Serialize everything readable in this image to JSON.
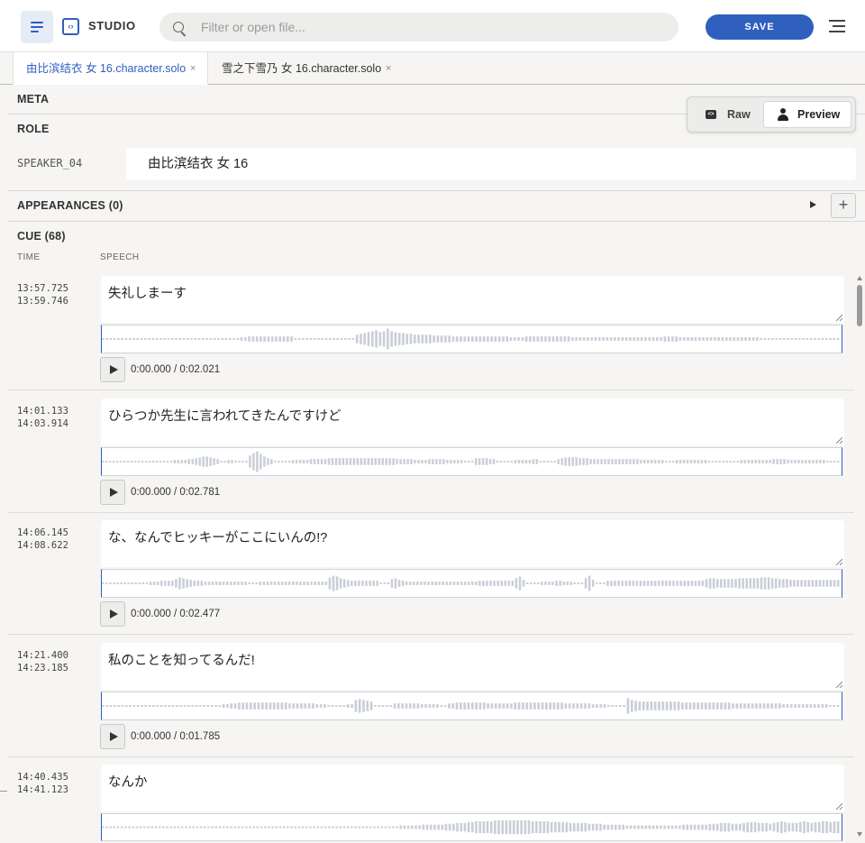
{
  "app": {
    "title": "STUDIO"
  },
  "search": {
    "placeholder": "Filter or open file..."
  },
  "toolbar": {
    "save_label": "SAVE"
  },
  "tabs": [
    {
      "label": "由比滨结衣 女 16.character.solo",
      "close": "×",
      "active": true
    },
    {
      "label": "雪之下雪乃 女 16.character.solo",
      "close": "×",
      "active": false
    }
  ],
  "view_toggle": {
    "raw_label": "Raw",
    "preview_label": "Preview",
    "raw_icon": "<>",
    "selected": "Preview"
  },
  "sections": {
    "meta": "META",
    "role": "ROLE",
    "appearances": "APPEARANCES (0)",
    "appearances_add": "+",
    "cue": "CUE (68)"
  },
  "role": {
    "key": "SPEAKER_04",
    "value": "由比滨结衣 女 16"
  },
  "cue_columns": {
    "time": "TIME",
    "speech": "SPEECH"
  },
  "cues": [
    {
      "start": "13:57.725",
      "end": "13:59.746",
      "text": "失礼しまーす",
      "playback": "0:00.000 / 0:02.021",
      "wave": [
        1,
        1,
        1,
        1,
        1,
        1,
        1,
        1,
        1,
        1,
        1,
        1,
        1,
        1,
        1,
        1,
        1,
        1,
        1,
        1,
        1,
        1,
        1,
        1,
        1,
        1,
        1,
        1,
        1,
        1,
        1,
        1,
        1,
        1,
        1,
        1,
        2,
        2,
        3,
        3,
        3,
        3,
        3,
        3,
        3,
        3,
        3,
        3,
        3,
        3,
        1,
        1,
        1,
        1,
        1,
        1,
        1,
        1,
        1,
        1,
        1,
        1,
        1,
        1,
        1,
        1,
        5,
        6,
        7,
        8,
        9,
        10,
        8,
        9,
        12,
        9,
        8,
        7,
        7,
        6,
        6,
        5,
        5,
        5,
        5,
        5,
        4,
        4,
        4,
        4,
        4,
        3,
        3,
        3,
        3,
        3,
        3,
        3,
        3,
        3,
        3,
        3,
        3,
        3,
        3,
        3,
        2,
        2,
        2,
        2,
        3,
        3,
        3,
        3,
        3,
        3,
        3,
        3,
        3,
        3,
        3,
        3,
        2,
        2,
        2,
        2,
        2,
        2,
        2,
        2,
        2,
        2,
        2,
        2,
        2,
        2,
        2,
        2,
        2,
        2,
        2,
        2,
        2,
        2,
        2,
        2,
        3,
        3,
        3,
        3,
        2,
        2,
        2,
        2,
        2,
        2,
        2,
        2,
        2,
        2,
        2,
        2,
        2,
        2,
        2,
        2,
        2,
        2,
        2,
        2,
        2,
        1,
        1,
        1,
        1,
        1,
        1,
        1,
        1,
        1,
        1,
        1,
        1,
        1,
        1,
        1,
        1,
        1,
        1,
        1,
        1,
        1
      ]
    },
    {
      "start": "14:01.133",
      "end": "14:03.914",
      "text": "ひらつか先生に言われてきたんですけど",
      "playback": "0:00.000 / 0:02.781",
      "wave": [
        1,
        1,
        1,
        1,
        1,
        1,
        1,
        1,
        1,
        1,
        1,
        1,
        1,
        1,
        1,
        1,
        1,
        1,
        1,
        1,
        2,
        2,
        2,
        2,
        3,
        3,
        4,
        5,
        6,
        6,
        5,
        4,
        3,
        1,
        1,
        2,
        2,
        1,
        1,
        1,
        1,
        7,
        10,
        12,
        9,
        6,
        4,
        3,
        1,
        1,
        1,
        1,
        1,
        2,
        2,
        2,
        2,
        2,
        3,
        3,
        3,
        3,
        3,
        4,
        4,
        4,
        4,
        4,
        4,
        4,
        4,
        4,
        4,
        4,
        4,
        4,
        4,
        4,
        4,
        4,
        4,
        4,
        3,
        3,
        3,
        3,
        3,
        2,
        2,
        2,
        2,
        3,
        3,
        3,
        3,
        3,
        2,
        2,
        2,
        2,
        2,
        1,
        1,
        1,
        4,
        4,
        4,
        4,
        3,
        3,
        1,
        1,
        1,
        1,
        1,
        2,
        2,
        2,
        2,
        2,
        3,
        3,
        1,
        1,
        1,
        1,
        1,
        3,
        4,
        5,
        5,
        5,
        5,
        4,
        4,
        4,
        3,
        3,
        3,
        3,
        3,
        3,
        3,
        3,
        3,
        3,
        3,
        3,
        3,
        3,
        2,
        2,
        2,
        2,
        2,
        2,
        2,
        1,
        1,
        1,
        2,
        2,
        2,
        2,
        2,
        2,
        2,
        2,
        2,
        1,
        1,
        1,
        1,
        1,
        1,
        1,
        1,
        1,
        2,
        2,
        2,
        2,
        2,
        2,
        2,
        2,
        2,
        3,
        3,
        3,
        3,
        2,
        2,
        2,
        2,
        2,
        2,
        2,
        2,
        2,
        2,
        2,
        1,
        1,
        1,
        1
      ]
    },
    {
      "start": "14:06.145",
      "end": "14:08.622",
      "text": "な、なんでヒッキーがここにいんの!?",
      "playback": "0:00.000 / 0:02.477",
      "wave": [
        1,
        1,
        1,
        1,
        1,
        1,
        1,
        1,
        1,
        1,
        1,
        1,
        1,
        2,
        2,
        2,
        3,
        3,
        3,
        3,
        5,
        7,
        6,
        5,
        4,
        3,
        3,
        3,
        2,
        2,
        2,
        2,
        2,
        2,
        2,
        2,
        2,
        2,
        2,
        2,
        1,
        1,
        1,
        2,
        2,
        2,
        2,
        2,
        2,
        2,
        2,
        2,
        2,
        2,
        2,
        2,
        2,
        2,
        2,
        2,
        2,
        2,
        7,
        9,
        8,
        6,
        5,
        4,
        3,
        3,
        3,
        3,
        3,
        3,
        3,
        3,
        1,
        1,
        1,
        5,
        6,
        4,
        3,
        2,
        2,
        2,
        2,
        2,
        2,
        2,
        2,
        2,
        2,
        2,
        2,
        2,
        2,
        2,
        2,
        2,
        2,
        2,
        2,
        3,
        3,
        3,
        3,
        3,
        3,
        3,
        3,
        3,
        3,
        6,
        8,
        4,
        1,
        1,
        1,
        1,
        2,
        2,
        2,
        2,
        3,
        3,
        2,
        2,
        2,
        1,
        1,
        1,
        6,
        9,
        4,
        1,
        1,
        1,
        3,
        3,
        3,
        3,
        3,
        3,
        3,
        3,
        3,
        3,
        3,
        3,
        3,
        3,
        3,
        3,
        3,
        3,
        3,
        3,
        3,
        3,
        3,
        3,
        3,
        3,
        3,
        5,
        6,
        6,
        5,
        5,
        5,
        5,
        5,
        5,
        6,
        6,
        6,
        6,
        6,
        6,
        7,
        7,
        7,
        6,
        6,
        5,
        5,
        5,
        4,
        4,
        4,
        4,
        4,
        4,
        4,
        4,
        4,
        4,
        4,
        4,
        4,
        4
      ]
    },
    {
      "start": "14:21.400",
      "end": "14:23.185",
      "text": "私のことを知ってるんだ!",
      "playback": "0:00.000 / 0:01.785",
      "wave": [
        1,
        1,
        1,
        1,
        1,
        1,
        1,
        1,
        1,
        1,
        1,
        1,
        1,
        1,
        1,
        1,
        1,
        1,
        1,
        1,
        1,
        1,
        1,
        1,
        1,
        1,
        1,
        1,
        1,
        1,
        1,
        2,
        2,
        3,
        3,
        4,
        4,
        4,
        4,
        4,
        4,
        4,
        4,
        4,
        4,
        4,
        4,
        4,
        3,
        3,
        3,
        3,
        3,
        3,
        3,
        2,
        2,
        2,
        1,
        1,
        1,
        1,
        1,
        2,
        2,
        7,
        8,
        7,
        6,
        5,
        1,
        1,
        1,
        1,
        1,
        3,
        3,
        3,
        3,
        3,
        3,
        3,
        2,
        2,
        2,
        2,
        2,
        1,
        1,
        3,
        3,
        4,
        4,
        4,
        4,
        4,
        4,
        4,
        4,
        3,
        3,
        3,
        3,
        3,
        3,
        3,
        4,
        4,
        4,
        4,
        4,
        4,
        4,
        4,
        4,
        4,
        4,
        4,
        4,
        3,
        3,
        3,
        3,
        3,
        3,
        3,
        2,
        2,
        2,
        2,
        1,
        1,
        1,
        1,
        1,
        9,
        7,
        6,
        5,
        5,
        5,
        5,
        5,
        5,
        5,
        5,
        5,
        5,
        5,
        4,
        4,
        4,
        4,
        4,
        4,
        4,
        4,
        4,
        4,
        4,
        4,
        4,
        3,
        3,
        3,
        3,
        3,
        3,
        3,
        3,
        3,
        3,
        3,
        3,
        3,
        2,
        2,
        2,
        2,
        2,
        2,
        2,
        2,
        2,
        2,
        2,
        2,
        1,
        1,
        1
      ]
    },
    {
      "start": "14:40.435",
      "end": "14:41.123",
      "text": "なんか",
      "playback": "",
      "wave": [
        1,
        1,
        1,
        1,
        1,
        1,
        1,
        1,
        1,
        1,
        1,
        1,
        1,
        1,
        1,
        1,
        1,
        1,
        1,
        1,
        1,
        1,
        1,
        1,
        1,
        1,
        1,
        1,
        1,
        1,
        1,
        1,
        1,
        1,
        1,
        1,
        1,
        1,
        1,
        1,
        1,
        1,
        1,
        1,
        1,
        1,
        1,
        1,
        1,
        1,
        1,
        1,
        1,
        1,
        1,
        1,
        1,
        1,
        1,
        1,
        1,
        1,
        1,
        1,
        1,
        1,
        1,
        1,
        1,
        1,
        1,
        1,
        1,
        1,
        1,
        1,
        1,
        1,
        1,
        2,
        2,
        2,
        2,
        2,
        2,
        3,
        3,
        3,
        3,
        3,
        3,
        4,
        4,
        4,
        5,
        5,
        5,
        6,
        6,
        7,
        7,
        7,
        7,
        7,
        8,
        8,
        8,
        8,
        8,
        8,
        8,
        8,
        8,
        8,
        7,
        7,
        7,
        7,
        7,
        6,
        6,
        6,
        6,
        6,
        5,
        5,
        5,
        5,
        5,
        4,
        4,
        4,
        4,
        3,
        3,
        3,
        3,
        3,
        3,
        2,
        2,
        2,
        2,
        2,
        2,
        2,
        2,
        2,
        2,
        2,
        2,
        2,
        2,
        2,
        3,
        3,
        3,
        3,
        3,
        3,
        3,
        4,
        4,
        4,
        5,
        5,
        5,
        4,
        4,
        4,
        5,
        6,
        6,
        6,
        5,
        5,
        5,
        4,
        5,
        6,
        7,
        6,
        5,
        5,
        5,
        6,
        7,
        6,
        5,
        6,
        6,
        7,
        7,
        6,
        7,
        7
      ]
    }
  ],
  "colors": {
    "accent": "#2f5fbf",
    "wave_bar": "#c9ced7",
    "background": "#f6f5f3"
  },
  "icons": {
    "menu": "menu-icon",
    "studio": "code-brackets-icon",
    "search": "search-icon",
    "more": "menu-lines-icon",
    "play": "play-icon",
    "add": "plus-icon",
    "person": "person-icon"
  }
}
